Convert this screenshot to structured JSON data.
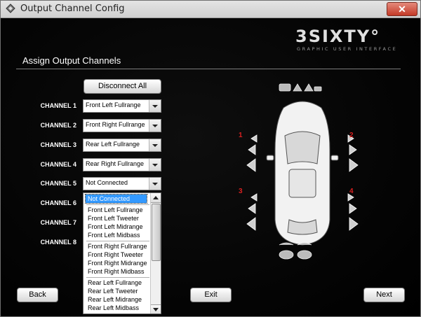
{
  "window": {
    "title": "Output Channel Config",
    "close_label": "✕"
  },
  "logo": {
    "main": "3SIXTY°",
    "sub": "GRAPHIC USER INTERFACE"
  },
  "section_title": "Assign Output Channels",
  "buttons": {
    "disconnect_all": "Disconnect All",
    "back": "Back",
    "exit": "Exit",
    "next": "Next"
  },
  "channels": [
    {
      "label": "CHANNEL 1",
      "value": "Front Left Fullrange"
    },
    {
      "label": "CHANNEL 2",
      "value": "Front Right Fullrange"
    },
    {
      "label": "CHANNEL 3",
      "value": "Rear Left Fullrange"
    },
    {
      "label": "CHANNEL 4",
      "value": "Rear Right Fullrange"
    },
    {
      "label": "CHANNEL 5",
      "value": "Not Connected"
    },
    {
      "label": "CHANNEL 6",
      "value": ""
    },
    {
      "label": "CHANNEL 7",
      "value": ""
    },
    {
      "label": "CHANNEL 8",
      "value": ""
    }
  ],
  "dropdown": {
    "options": [
      "Not Connected",
      "Front Left Fullrange",
      "Front Left Tweeter",
      "Front Left Midrange",
      "Front Left Midbass",
      "Front Right Fullrange",
      "Front Right Tweeter",
      "Front Right Midrange",
      "Front Right Midbass",
      "Rear Left Fullrange",
      "Rear Left Tweeter",
      "Rear Left Midrange",
      "Rear Left Midbass"
    ],
    "selected_index": 0
  },
  "diagram": {
    "labels": [
      "1",
      "2",
      "3",
      "4"
    ]
  },
  "colors": {
    "accent_red": "#d92020",
    "selection_blue": "#3399ff"
  }
}
